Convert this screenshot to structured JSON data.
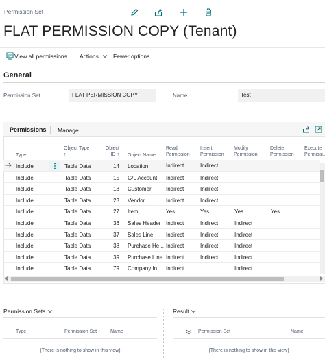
{
  "header": {
    "breadcrumb": "Permission Set",
    "title": "FLAT PERMISSION COPY (Tenant)"
  },
  "actionbar": {
    "view_all": "View all permissions",
    "actions": "Actions",
    "fewer_options": "Fewer options"
  },
  "general": {
    "heading": "General",
    "permission_set_label": "Permission Set",
    "permission_set_value": "FLAT PERMISSION COPY",
    "name_label": "Name",
    "name_value": "Test"
  },
  "permissions": {
    "title": "Permissions",
    "manage": "Manage",
    "columns": {
      "type": "Type",
      "object_type": "Object Type",
      "object_type_sort": "↑",
      "object_id_1": "Object",
      "object_id_2": "ID ↑",
      "object_name": "Object Name",
      "read_1": "Read",
      "read_2": "Permission",
      "insert_1": "Insert",
      "insert_2": "Permission",
      "modify_1": "Modify",
      "modify_2": "Permission",
      "delete_1": "Delete",
      "delete_2": "Permission",
      "execute_1": "Execute",
      "execute_2": "Permissi..."
    },
    "rows": [
      {
        "type": "Include",
        "object_type": "Table Data",
        "id": "14",
        "name": "Location",
        "read": "Indirect",
        "insert": "Indirect",
        "modify": "_",
        "delete": "_",
        "execute": "_"
      },
      {
        "type": "Include",
        "object_type": "Table Data",
        "id": "15",
        "name": "G/L Account",
        "read": "Indirect",
        "insert": "Indirect",
        "modify": "",
        "delete": "",
        "execute": ""
      },
      {
        "type": "Include",
        "object_type": "Table Data",
        "id": "18",
        "name": "Customer",
        "read": "Indirect",
        "insert": "Indirect",
        "modify": "",
        "delete": "",
        "execute": ""
      },
      {
        "type": "Include",
        "object_type": "Table Data",
        "id": "23",
        "name": "Vendor",
        "read": "Indirect",
        "insert": "Indirect",
        "modify": "",
        "delete": "",
        "execute": ""
      },
      {
        "type": "Include",
        "object_type": "Table Data",
        "id": "27",
        "name": "Item",
        "read": "Yes",
        "insert": "Yes",
        "modify": "Yes",
        "delete": "Yes",
        "execute": ""
      },
      {
        "type": "Include",
        "object_type": "Table Data",
        "id": "36",
        "name": "Sales Header",
        "read": "Indirect",
        "insert": "Indirect",
        "modify": "Indirect",
        "delete": "",
        "execute": ""
      },
      {
        "type": "Include",
        "object_type": "Table Data",
        "id": "37",
        "name": "Sales Line",
        "read": "Indirect",
        "insert": "Indirect",
        "modify": "Indirect",
        "delete": "",
        "execute": ""
      },
      {
        "type": "Include",
        "object_type": "Table Data",
        "id": "38",
        "name": "Purchase He...",
        "read": "Indirect",
        "insert": "Indirect",
        "modify": "Indirect",
        "delete": "",
        "execute": ""
      },
      {
        "type": "Include",
        "object_type": "Table Data",
        "id": "39",
        "name": "Purchase Line",
        "read": "Indirect",
        "insert": "Indirect",
        "modify": "Indirect",
        "delete": "",
        "execute": ""
      },
      {
        "type": "Include",
        "object_type": "Table Data",
        "id": "79",
        "name": "Company In...",
        "read": "Indirect",
        "insert": "",
        "modify": "Indirect",
        "delete": "",
        "execute": ""
      }
    ]
  },
  "permission_sets_part": {
    "title": "Permission Sets",
    "col_type": "Type",
    "col_permission_set": "Permission Set ↑",
    "col_name": "Name",
    "empty": "(There is nothing to show in this view)"
  },
  "result_part": {
    "title": "Result",
    "col_permission_set": "Permission Set",
    "col_name": "Name",
    "empty": "(There is nothing to show in this view)"
  },
  "colors": {
    "accent": "#00707a",
    "text": "#212121",
    "muted": "#505c6d"
  },
  "icons": [
    "edit-icon",
    "share-icon",
    "add-icon",
    "delete-icon",
    "view-permissions-icon",
    "chevron-down-icon",
    "share-icon",
    "expand-icon",
    "arrow-right-icon",
    "more-options-icon"
  ]
}
